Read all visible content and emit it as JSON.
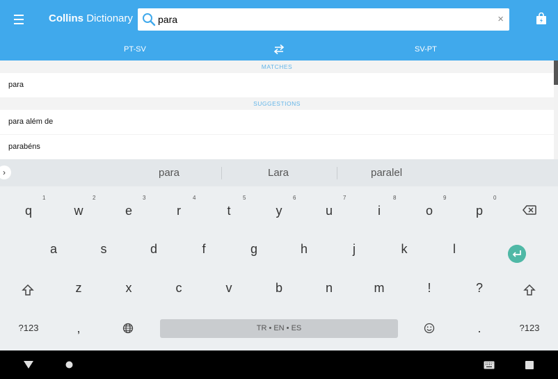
{
  "header": {
    "title_bold": "Collins",
    "title_rest": "Dictionary",
    "search_value": "para",
    "clear_symbol": "×",
    "tab_left": "PT-SV",
    "tab_right": "SV-PT",
    "icons": [
      "menu-icon",
      "search-icon",
      "shopping-bag-icon",
      "swap-icon",
      "close-icon"
    ]
  },
  "results": {
    "matches_header": "MATCHES",
    "matches": [
      "para"
    ],
    "suggestions_header": "SUGGESTIONS",
    "suggestions": [
      "para além de",
      "parabéns"
    ]
  },
  "keyboard": {
    "expand_symbol": "›",
    "suggestions": [
      "para",
      "Lara",
      "paralel"
    ],
    "row1": [
      "q",
      "w",
      "e",
      "r",
      "t",
      "y",
      "u",
      "i",
      "o",
      "p"
    ],
    "row1_numbers": [
      "1",
      "2",
      "3",
      "4",
      "5",
      "6",
      "7",
      "8",
      "9",
      "0"
    ],
    "row2": [
      "a",
      "s",
      "d",
      "f",
      "g",
      "h",
      "j",
      "k",
      "l"
    ],
    "row3": [
      "z",
      "x",
      "c",
      "v",
      "b",
      "n",
      "m",
      "!",
      "?"
    ],
    "symbols_label": "?123",
    "comma": ",",
    "period": ".",
    "space_label": "TR • EN • ES",
    "icons": [
      "backspace-icon",
      "enter-icon",
      "shift-icon",
      "globe-icon",
      "emoji-icon"
    ]
  },
  "navbar": {
    "icons": [
      "back-icon",
      "home-icon",
      "keyboard-icon",
      "recents-icon"
    ]
  },
  "colors": {
    "header": "#40a9ec",
    "section_header_text": "#63b5e8",
    "enter_key": "#4fb8a6"
  }
}
